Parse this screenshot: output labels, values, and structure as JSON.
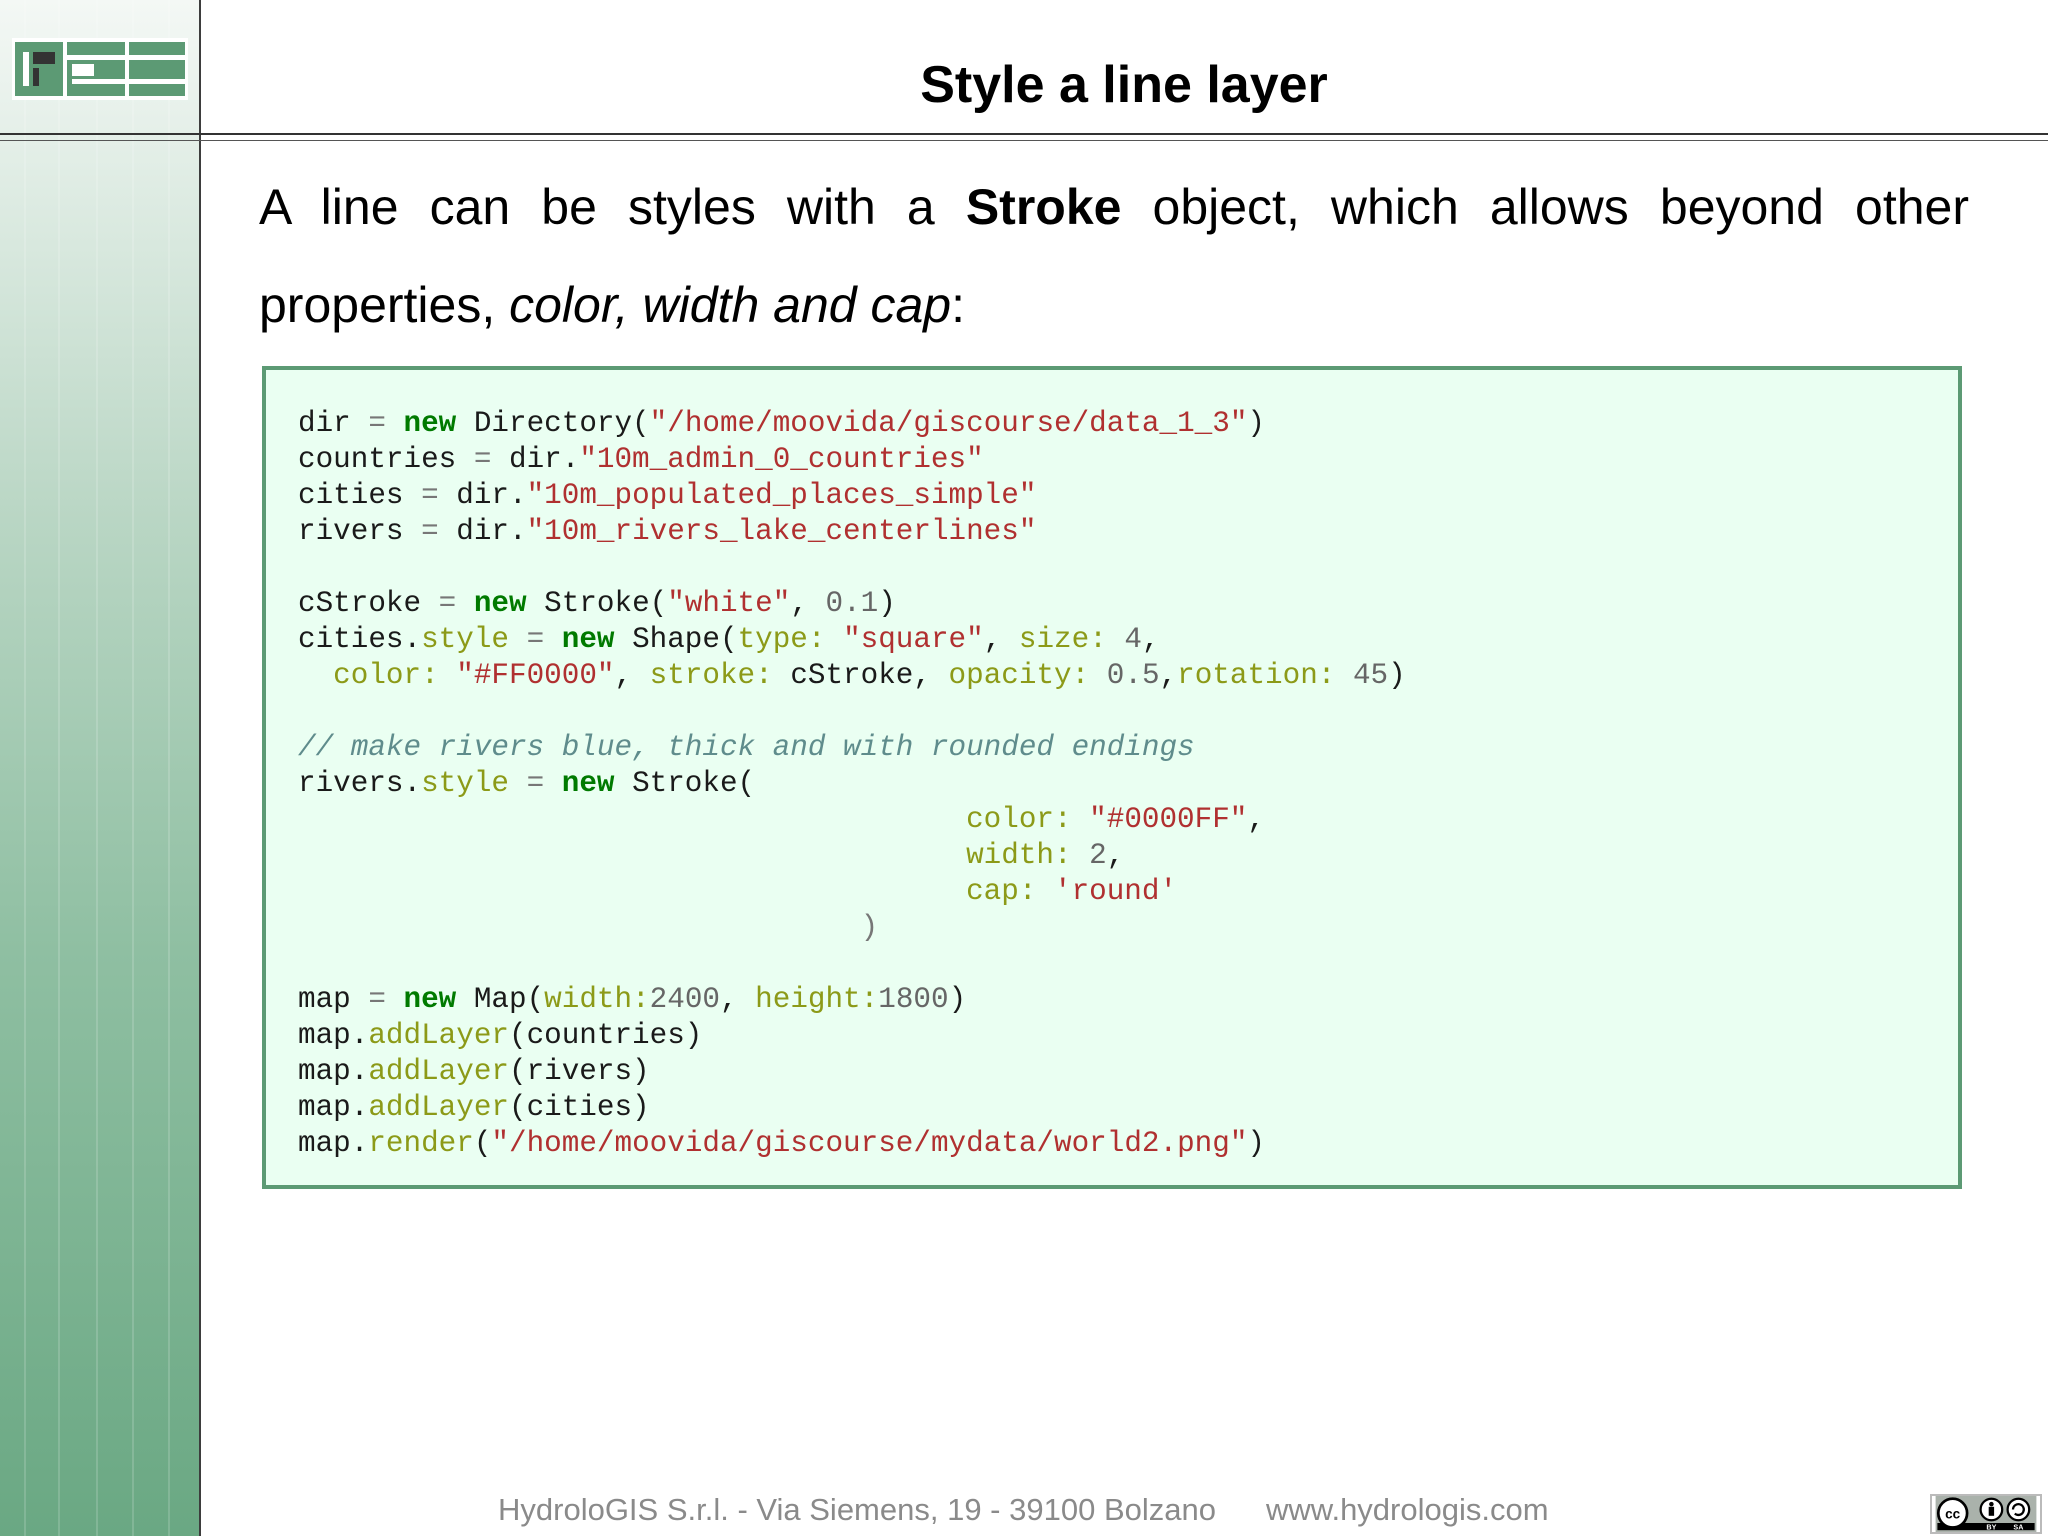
{
  "slide": {
    "title": "Style a line layer",
    "intro": {
      "part1": "A line can be styles with a ",
      "bold": "Stroke",
      "part2": " object, which allows beyond other properties, ",
      "italic": "color, width and cap",
      "part3": ":"
    }
  },
  "code": {
    "l1": {
      "a": "dir ",
      "b": "= ",
      "kw": "new",
      "c": " Directory(",
      "s": "\"/home/moovida/giscourse/data_1_3\"",
      "d": ")"
    },
    "l2": {
      "a": "countries ",
      "b": "= ",
      "c": "dir.",
      "s": "\"10m_admin_0_countries\""
    },
    "l3": {
      "a": "cities ",
      "b": "= ",
      "c": "dir.",
      "s": "\"10m_populated_places_simple\""
    },
    "l4": {
      "a": "rivers ",
      "b": "= ",
      "c": "dir.",
      "s": "\"10m_rivers_lake_centerlines\""
    },
    "l5": {
      "a": "cStroke ",
      "b": "= ",
      "kw": "new",
      "c": " Stroke(",
      "s": "\"white\"",
      "d": ", ",
      "n": "0.1",
      "e": ")"
    },
    "l6": {
      "a": "cities.",
      "p": "style",
      "b": " = ",
      "kw": "new",
      "c": " Shape(",
      "p2": "type: ",
      "s": "\"square\"",
      "d": ", ",
      "p3": "size: ",
      "n": "4",
      "e": ","
    },
    "l7": {
      "ind": "  ",
      "p": "color: ",
      "s": "\"#FF0000\"",
      "d": ", ",
      "p2": "stroke: ",
      "c": "cStroke, ",
      "p3": "opacity: ",
      "n": "0.5",
      "e": ",",
      "p4": "rotation: ",
      "n2": "45",
      "f": ")"
    },
    "l8": {
      "cm": "// make rivers blue, thick and with rounded endings"
    },
    "l9": {
      "a": "rivers.",
      "p": "style",
      "b": " = ",
      "kw": "new",
      "c": " Stroke("
    },
    "l10": {
      "ind": "                                      ",
      "p": "color: ",
      "s": "\"#0000FF\"",
      "d": ","
    },
    "l11": {
      "ind": "                                      ",
      "p": "width: ",
      "n": "2",
      "d": ","
    },
    "l12": {
      "ind": "                                      ",
      "p": "cap: ",
      "s": "'round'"
    },
    "l13": {
      "ind": "                                89",
      "c": ")"
    },
    "l14": {
      "a": "map ",
      "b": "= ",
      "kw": "new",
      "c": " Map(",
      "p": "width:",
      "n": "2400",
      "d": ", ",
      "p2": "height:",
      "n2": "1800",
      "e": ")"
    },
    "l15": {
      "a": "map.",
      "p": "addLayer",
      "c": "(countries)"
    },
    "l16": {
      "a": "map.",
      "p": "addLayer",
      "c": "(rivers)"
    },
    "l17": {
      "a": "map.",
      "p": "addLayer",
      "c": "(cities)"
    },
    "l18": {
      "a": "map.",
      "p": "render",
      "c": "(",
      "s": "\"/home/moovida/giscourse/mydata/world2.png\"",
      "d": ")"
    }
  },
  "footer": {
    "address": "HydroloGIS S.r.l. - Via Siemens, 19 - 39100 Bolzano",
    "website": "www.hydrologis.com"
  },
  "license_badge": {
    "icons": [
      "cc-icon",
      "by-icon",
      "sa-icon"
    ],
    "labels": [
      "BY",
      "SA"
    ]
  },
  "colors": {
    "accent": "#5c9a74",
    "code_bg": "#eafff2",
    "keyword": "#007a00",
    "string": "#b03030"
  }
}
